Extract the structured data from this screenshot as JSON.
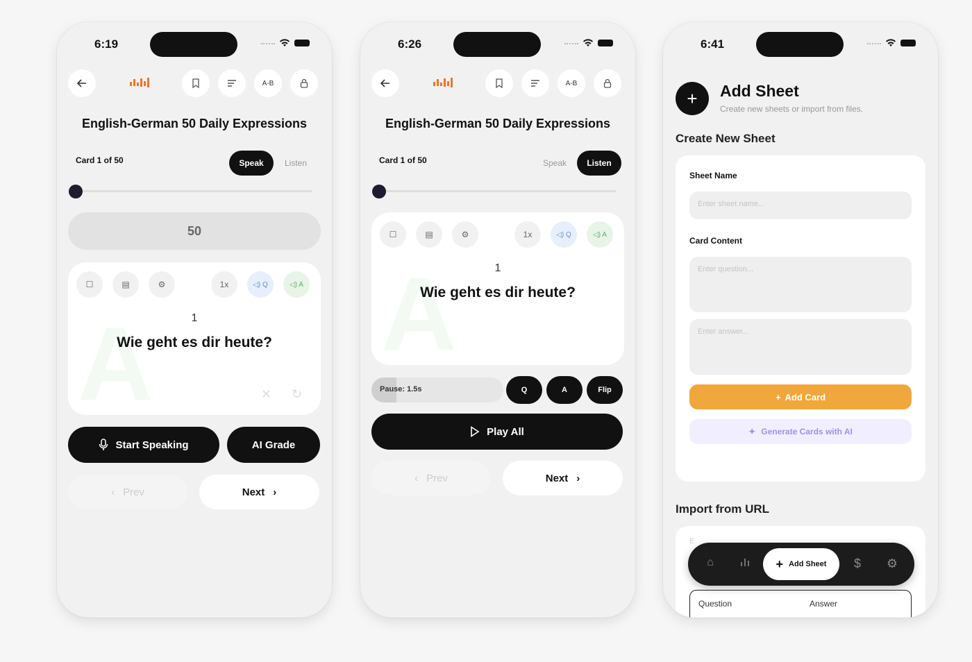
{
  "phones": [
    {
      "time": "6:19",
      "deck_title": "English-German 50 Daily Expressions",
      "card_count_label": "Card 1 of 50",
      "mode_options": [
        "Speak",
        "Listen"
      ],
      "active_mode": "Speak",
      "progress": 0.0,
      "total_pill": "50",
      "card": {
        "number": "1",
        "question": "Wie geht es dir heute?",
        "ghost_letter": "A",
        "speed": "1x",
        "speak_q": "◁) Q",
        "speak_a": "◁) A"
      },
      "start_speaking": "Start Speaking",
      "ai_grade": "AI Grade",
      "prev": "Prev",
      "next": "Next"
    },
    {
      "time": "6:26",
      "deck_title": "English-German 50 Daily Expressions",
      "card_count_label": "Card 1 of 50",
      "mode_options": [
        "Speak",
        "Listen"
      ],
      "active_mode": "Listen",
      "progress": 0.0,
      "card": {
        "number": "1",
        "question": "Wie geht es dir heute?",
        "ghost_letter": "A",
        "speed": "1x",
        "speak_q": "◁) Q",
        "speak_a": "◁) A"
      },
      "pause_label": "Pause: 1.5s",
      "q_button": "Q",
      "a_button": "A",
      "flip_button": "Flip",
      "play_all": "Play All",
      "prev": "Prev",
      "next": "Next"
    },
    {
      "time": "6:41",
      "title": "Add Sheet",
      "subtitle": "Create new sheets or import from files.",
      "create_section": "Create New Sheet",
      "sheet_name_label": "Sheet Name",
      "sheet_name_placeholder": "Enter sheet name...",
      "card_content_label": "Card Content",
      "question_placeholder": "Enter question...",
      "answer_placeholder": "Enter answer...",
      "add_card": "Add Card",
      "generate_ai": "Generate Cards with AI",
      "import_section": "Import from URL",
      "import_placeholder": "E",
      "table_headers": [
        "Question",
        "Answer"
      ],
      "tab_active": "Add Sheet"
    }
  ],
  "colors": {
    "accent_orange": "#f0a73b",
    "logo_orange": "#e8762c",
    "ai_purple": "#9b93e6",
    "dark": "#111111"
  },
  "icons": {
    "back": "arrow-left-icon",
    "bookmark": "bookmark-icon",
    "list": "list-icon",
    "ab": "A-B",
    "lock": "lock-icon"
  }
}
